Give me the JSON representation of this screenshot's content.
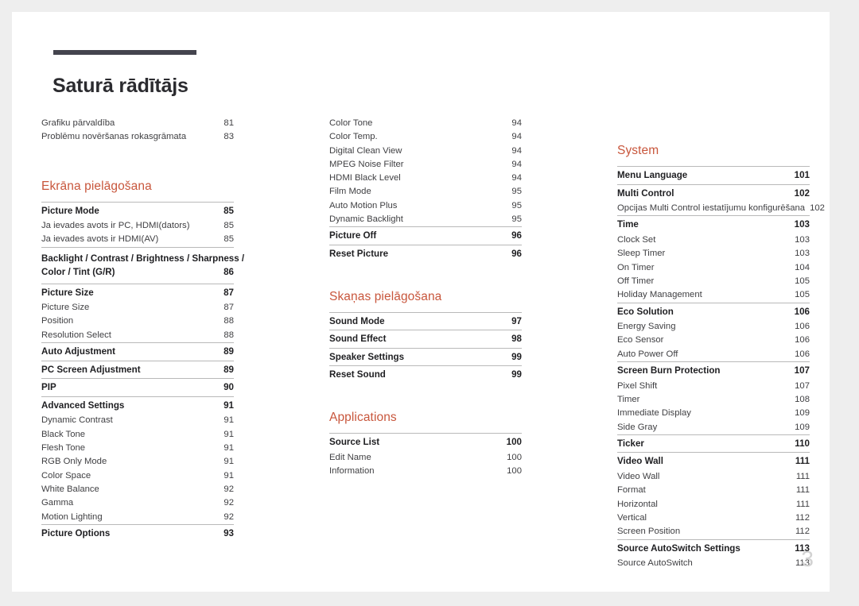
{
  "document": {
    "title": "Saturā rādītājs",
    "page_number": "3"
  },
  "colors": {
    "accent_orange": "#c8563c",
    "title_rule": "#44444e",
    "rule": "#b9b9b9",
    "folio": "#d2d2d2",
    "page_bg": "#ffffff",
    "canvas_bg": "#eeeeee"
  },
  "columns": [
    {
      "groups": [
        {
          "rule": false,
          "entries": [
            {
              "label": "Grafiku pārvaldība",
              "page": "81",
              "level": "sub"
            },
            {
              "label": "Problēmu novēršanas rokasgrāmata",
              "page": "83",
              "level": "sub"
            }
          ]
        },
        {
          "section": "Ekrāna pielāgošana",
          "rule": true,
          "entries": [
            {
              "label": "Picture Mode",
              "page": "85",
              "level": "main"
            },
            {
              "label": "Ja ievades avots ir PC, HDMI(dators)",
              "page": "85",
              "level": "sub"
            },
            {
              "label": "Ja ievades avots ir HDMI(AV)",
              "page": "85",
              "level": "sub"
            }
          ]
        },
        {
          "rule": true,
          "wrapped": {
            "line1": "Backlight / Contrast / Brightness / Sharpness /",
            "line2": "Color / Tint (G/R)",
            "page": "86"
          }
        },
        {
          "rule": true,
          "entries": [
            {
              "label": "Picture Size",
              "page": "87",
              "level": "main"
            },
            {
              "label": "Picture Size",
              "page": "87",
              "level": "sub"
            },
            {
              "label": "Position",
              "page": "88",
              "level": "sub"
            },
            {
              "label": "Resolution Select",
              "page": "88",
              "level": "sub"
            }
          ]
        },
        {
          "rule": true,
          "entries": [
            {
              "label": "Auto Adjustment",
              "page": "89",
              "level": "main"
            }
          ]
        },
        {
          "rule": true,
          "entries": [
            {
              "label": "PC Screen Adjustment",
              "page": "89",
              "level": "main"
            }
          ]
        },
        {
          "rule": true,
          "entries": [
            {
              "label": "PIP",
              "page": "90",
              "level": "main"
            }
          ]
        },
        {
          "rule": true,
          "entries": [
            {
              "label": "Advanced Settings",
              "page": "91",
              "level": "main"
            },
            {
              "label": "Dynamic Contrast",
              "page": "91",
              "level": "sub"
            },
            {
              "label": "Black Tone",
              "page": "91",
              "level": "sub"
            },
            {
              "label": "Flesh Tone",
              "page": "91",
              "level": "sub"
            },
            {
              "label": "RGB Only Mode",
              "page": "91",
              "level": "sub"
            },
            {
              "label": "Color Space",
              "page": "91",
              "level": "sub"
            },
            {
              "label": "White Balance",
              "page": "92",
              "level": "sub"
            },
            {
              "label": "Gamma",
              "page": "92",
              "level": "sub"
            },
            {
              "label": "Motion Lighting",
              "page": "92",
              "level": "sub"
            }
          ]
        },
        {
          "rule": true,
          "entries": [
            {
              "label": "Picture Options",
              "page": "93",
              "level": "main"
            }
          ]
        }
      ]
    },
    {
      "groups": [
        {
          "rule": false,
          "entries": [
            {
              "label": "Color Tone",
              "page": "94",
              "level": "sub"
            },
            {
              "label": "Color Temp.",
              "page": "94",
              "level": "sub"
            },
            {
              "label": "Digital Clean View",
              "page": "94",
              "level": "sub"
            },
            {
              "label": "MPEG Noise Filter",
              "page": "94",
              "level": "sub"
            },
            {
              "label": "HDMI Black Level",
              "page": "94",
              "level": "sub"
            },
            {
              "label": "Film Mode",
              "page": "95",
              "level": "sub"
            },
            {
              "label": "Auto Motion Plus",
              "page": "95",
              "level": "sub"
            },
            {
              "label": "Dynamic Backlight",
              "page": "95",
              "level": "sub"
            }
          ]
        },
        {
          "rule": true,
          "entries": [
            {
              "label": "Picture Off",
              "page": "96",
              "level": "main"
            }
          ]
        },
        {
          "rule": true,
          "entries": [
            {
              "label": "Reset Picture",
              "page": "96",
              "level": "main"
            }
          ]
        },
        {
          "section": "Skaņas pielāgošana",
          "rule": true,
          "entries": [
            {
              "label": "Sound Mode",
              "page": "97",
              "level": "main"
            }
          ]
        },
        {
          "rule": true,
          "entries": [
            {
              "label": "Sound Effect",
              "page": "98",
              "level": "main"
            }
          ]
        },
        {
          "rule": true,
          "entries": [
            {
              "label": "Speaker Settings",
              "page": "99",
              "level": "main"
            }
          ]
        },
        {
          "rule": true,
          "entries": [
            {
              "label": "Reset Sound",
              "page": "99",
              "level": "main"
            }
          ]
        },
        {
          "section": "Applications",
          "rule": true,
          "entries": [
            {
              "label": "Source List",
              "page": "100",
              "level": "main"
            },
            {
              "label": "Edit Name",
              "page": "100",
              "level": "sub"
            },
            {
              "label": "Information",
              "page": "100",
              "level": "sub"
            }
          ]
        }
      ]
    },
    {
      "groups": [
        {
          "section": "System",
          "rule": true,
          "entries": [
            {
              "label": "Menu Language",
              "page": "101",
              "level": "main"
            }
          ]
        },
        {
          "rule": true,
          "entries": [
            {
              "label": "Multi Control",
              "page": "102",
              "level": "main"
            },
            {
              "label": "Opcijas Multi Control iestatījumu konfigurēšana",
              "page": "102",
              "level": "sub"
            }
          ]
        },
        {
          "rule": true,
          "entries": [
            {
              "label": "Time",
              "page": "103",
              "level": "main"
            },
            {
              "label": "Clock Set",
              "page": "103",
              "level": "sub"
            },
            {
              "label": "Sleep Timer",
              "page": "103",
              "level": "sub"
            },
            {
              "label": "On Timer",
              "page": "104",
              "level": "sub"
            },
            {
              "label": "Off Timer",
              "page": "105",
              "level": "sub"
            },
            {
              "label": "Holiday Management",
              "page": "105",
              "level": "sub"
            }
          ]
        },
        {
          "rule": true,
          "entries": [
            {
              "label": "Eco Solution",
              "page": "106",
              "level": "main"
            },
            {
              "label": "Energy Saving",
              "page": "106",
              "level": "sub"
            },
            {
              "label": "Eco Sensor",
              "page": "106",
              "level": "sub"
            },
            {
              "label": "Auto Power Off",
              "page": "106",
              "level": "sub"
            }
          ]
        },
        {
          "rule": true,
          "entries": [
            {
              "label": "Screen Burn Protection",
              "page": "107",
              "level": "main"
            },
            {
              "label": "Pixel Shift",
              "page": "107",
              "level": "sub"
            },
            {
              "label": "Timer",
              "page": "108",
              "level": "sub"
            },
            {
              "label": "Immediate Display",
              "page": "109",
              "level": "sub"
            },
            {
              "label": "Side Gray",
              "page": "109",
              "level": "sub"
            }
          ]
        },
        {
          "rule": true,
          "entries": [
            {
              "label": "Ticker",
              "page": "110",
              "level": "main"
            }
          ]
        },
        {
          "rule": true,
          "entries": [
            {
              "label": "Video Wall",
              "page": "111",
              "level": "main"
            },
            {
              "label": "Video Wall",
              "page": "111",
              "level": "sub"
            },
            {
              "label": "Format",
              "page": "111",
              "level": "sub"
            },
            {
              "label": "Horizontal",
              "page": "111",
              "level": "sub"
            },
            {
              "label": "Vertical",
              "page": "112",
              "level": "sub"
            },
            {
              "label": "Screen Position",
              "page": "112",
              "level": "sub"
            }
          ]
        },
        {
          "rule": true,
          "entries": [
            {
              "label": "Source AutoSwitch Settings",
              "page": "113",
              "level": "main"
            },
            {
              "label": "Source AutoSwitch",
              "page": "113",
              "level": "sub"
            }
          ]
        }
      ]
    }
  ]
}
